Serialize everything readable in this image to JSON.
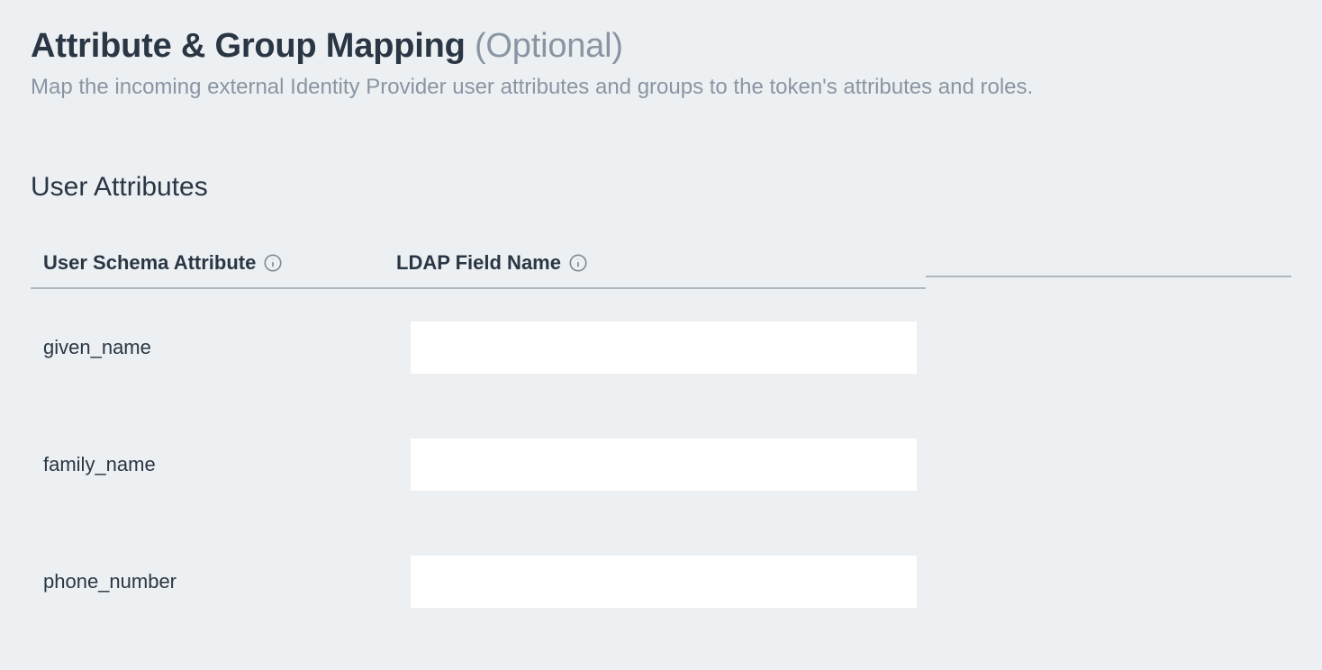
{
  "header": {
    "title_main": "Attribute & Group Mapping",
    "title_optional": "(Optional)",
    "subtitle": "Map the incoming external Identity Provider user attributes and groups to the token's attributes and roles."
  },
  "section": {
    "user_attributes_heading": "User Attributes"
  },
  "columns": {
    "schema_label": "User Schema Attribute",
    "ldap_label": "LDAP Field Name"
  },
  "rows": [
    {
      "schema": "given_name",
      "ldap_value": ""
    },
    {
      "schema": "family_name",
      "ldap_value": ""
    },
    {
      "schema": "phone_number",
      "ldap_value": ""
    }
  ]
}
